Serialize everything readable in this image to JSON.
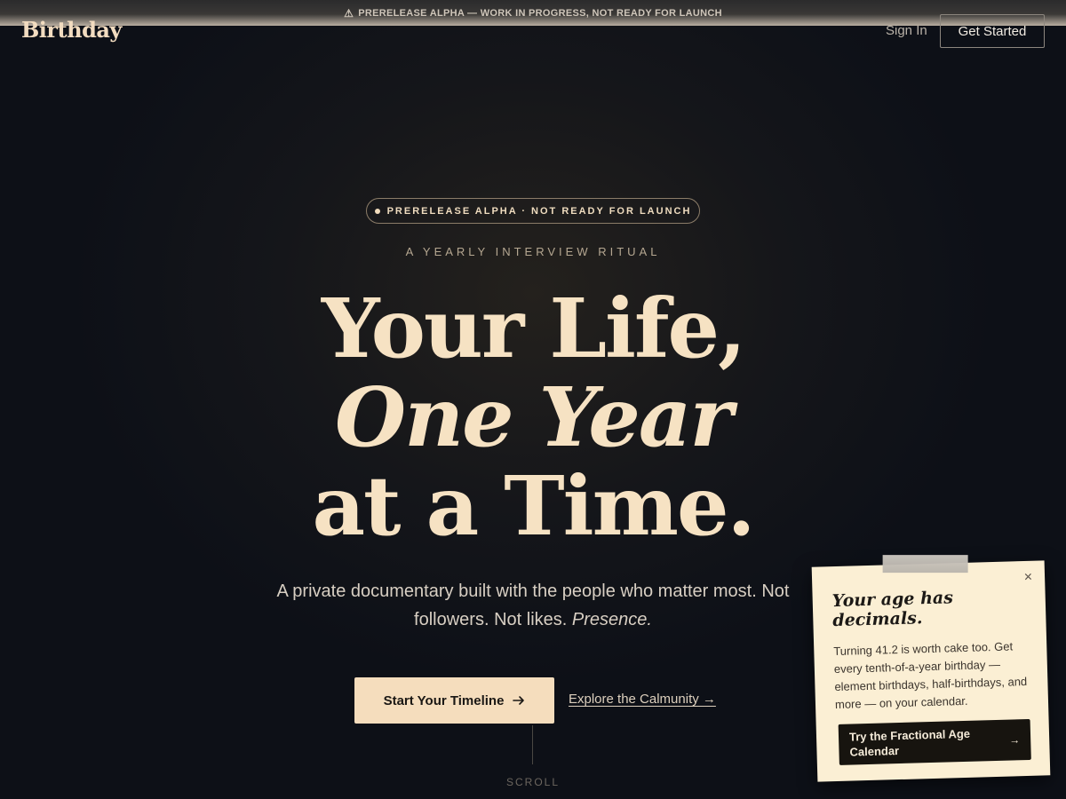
{
  "banner": {
    "icon": "warning-icon",
    "text": "PRERELEASE ALPHA — WORK IN PROGRESS, NOT READY FOR LAUNCH"
  },
  "header": {
    "logo": "Birthday",
    "sign_in": "Sign In",
    "get_started": "Get Started"
  },
  "hero": {
    "pill": "PRERELEASE ALPHA · NOT READY FOR LAUNCH",
    "eyebrow": "A YEARLY INTERVIEW RITUAL",
    "headline_line1": "Your Life,",
    "headline_line2": "One Year",
    "headline_line3": "at a Time.",
    "subtitle_main": "A private documentary built with the people who matter most. Not followers. Not likes.",
    "subtitle_em": "Presence.",
    "cta_primary": "Start Your Timeline",
    "cta_primary_icon": "arrow-right-icon",
    "cta_secondary": "Explore the Calmunity →",
    "scroll": "SCROLL"
  },
  "note": {
    "close": "×",
    "title": "Your age has decimals.",
    "body": "Turning 41.2 is worth cake too. Get every tenth-of-a-year birthday — element birthdays, half-birthdays, and more — on your calendar.",
    "button": "Try the Fractional Age Calendar",
    "button_icon": "arrow-right-icon"
  },
  "colors": {
    "accent": "#f5ddbd",
    "background": "#15161a",
    "note_bg": "#fbefd4"
  }
}
